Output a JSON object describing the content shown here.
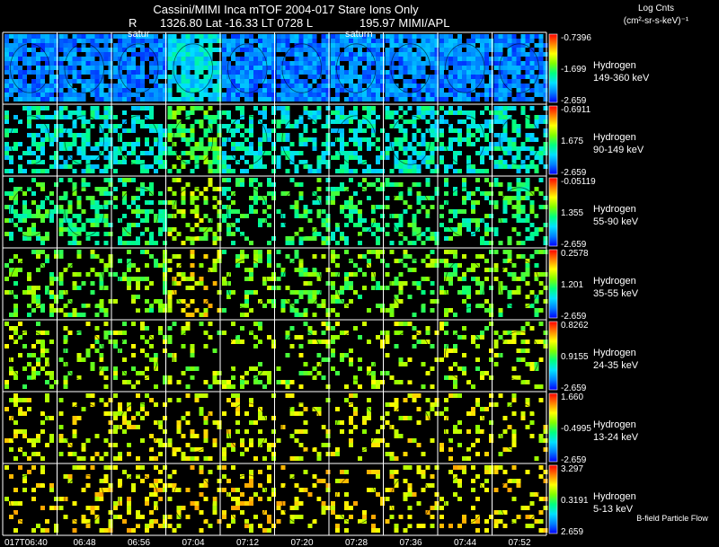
{
  "header": {
    "title_line1": "Cassini/MIMI Inca mTOF  2004-017   Stare   Ions Only",
    "title_line2_left": "R",
    "title_line2_mid": "1326.80 Lat -16.33 LT 0728 L",
    "title_line2_right": "195.97  MIMI/APL",
    "units_line1": "Log Cnts",
    "units_line2": "(cm²-sr-s-keV)⁻¹"
  },
  "footer": {
    "flow_label": "B-field Particle Flow"
  },
  "chart_data": {
    "type": "heatmap",
    "title": "Cassini/MIMI Inca mTOF  2004-017   Stare   Ions Only",
    "columns": 10,
    "time_labels": [
      "017T06:40",
      "06:48",
      "06:56",
      "07:04",
      "07:12",
      "07:20",
      "07:28",
      "07:36",
      "07:44",
      "07:52"
    ],
    "annotations": [
      {
        "text": "satur",
        "column": 2
      },
      {
        "text": "saturn",
        "column": 6
      }
    ],
    "rows": [
      {
        "species": "Hydrogen",
        "energy": "149-360 keV",
        "max": "-0.7396",
        "mid": "-1.699",
        "min": "-2.659",
        "density": 0.88,
        "level": 0.15,
        "spread": 0.1
      },
      {
        "species": "Hydrogen",
        "energy": "90-149 keV",
        "max": "-0.6911",
        "mid": "1.675",
        "min": "-2.659",
        "density": 0.52,
        "level": 0.34,
        "spread": 0.12
      },
      {
        "species": "Hydrogen",
        "energy": "55-90 keV",
        "max": "-0.05119",
        "mid": "1.355",
        "min": "-2.659",
        "density": 0.38,
        "level": 0.45,
        "spread": 0.11
      },
      {
        "species": "Hydrogen",
        "energy": "35-55 keV",
        "max": "0.2578",
        "mid": "1.201",
        "min": "-2.659",
        "density": 0.3,
        "level": 0.54,
        "spread": 0.12
      },
      {
        "species": "Hydrogen",
        "energy": "24-35 keV",
        "max": "0.8262",
        "mid": "0.9155",
        "min": "-2.659",
        "density": 0.24,
        "level": 0.6,
        "spread": 0.12
      },
      {
        "species": "Hydrogen",
        "energy": "13-24 keV",
        "max": "1.660",
        "mid": "-0.4995",
        "min": "-2.659",
        "density": 0.22,
        "level": 0.68,
        "spread": 0.1
      },
      {
        "species": "Hydrogen",
        "energy": "5-13 keV",
        "max": "3.297",
        "mid": "0.3191",
        "min": "2.659",
        "density": 0.22,
        "level": 0.72,
        "spread": 0.1
      }
    ],
    "colormap": [
      "#0000ff",
      "#0080ff",
      "#00e0ff",
      "#00ff80",
      "#80ff00",
      "#ffff00",
      "#ff8000",
      "#ff0000"
    ]
  }
}
